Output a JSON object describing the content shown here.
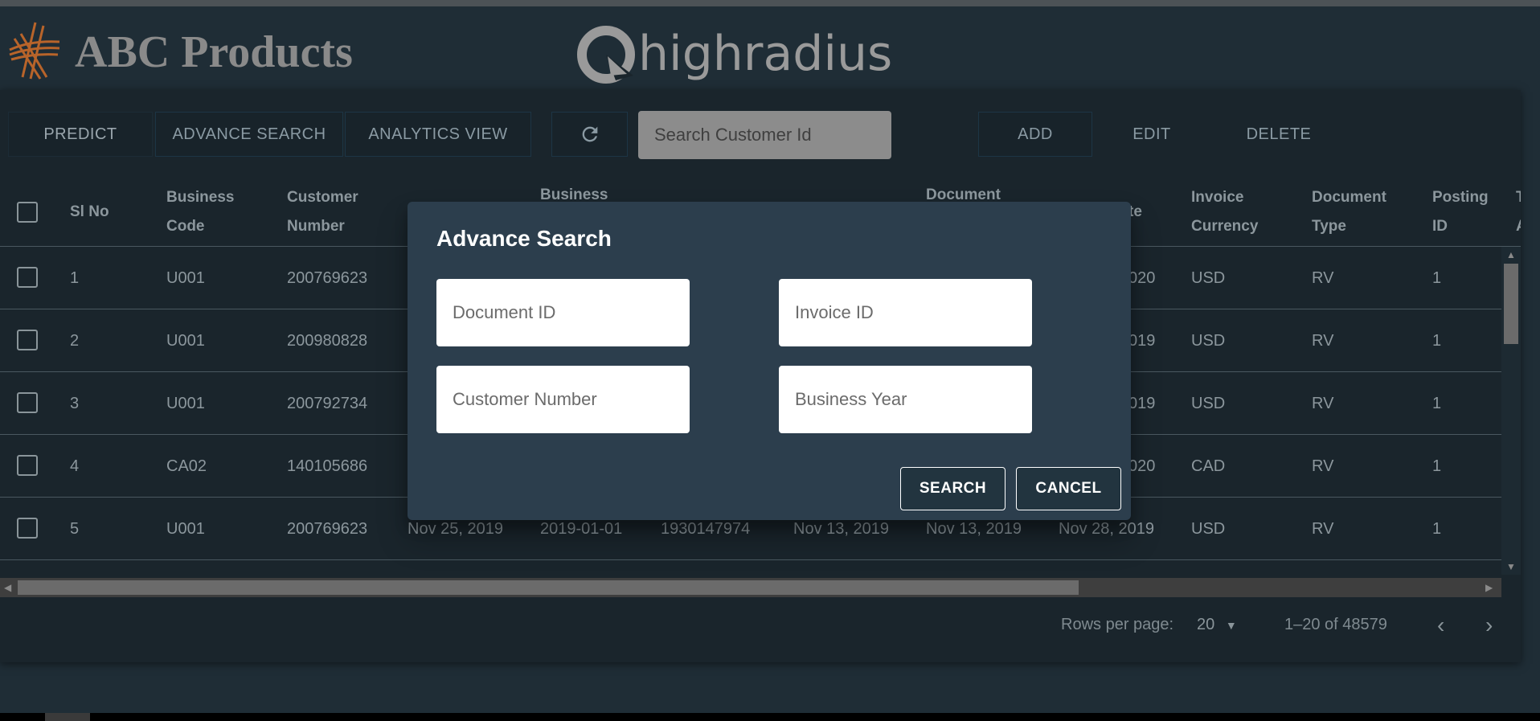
{
  "app": {
    "brand_title": "ABC Products",
    "partner_logo_text": "highradius"
  },
  "toolbar": {
    "predict_label": "PREDICT",
    "advance_search_label": "ADVANCE SEARCH",
    "analytics_view_label": "ANALYTICS VIEW",
    "search_placeholder": "Search Customer Id",
    "add_label": "ADD",
    "edit_label": "EDIT",
    "delete_label": "DELETE"
  },
  "table": {
    "headers": {
      "sl_no": "Sl No",
      "business_code_1": "Business",
      "business_code_2": "Code",
      "customer_number_1": "Customer",
      "customer_number_2": "Number",
      "business_year_1": "Business",
      "document_1": "Document",
      "date_partial": "te",
      "invoice_currency_1": "Invoice",
      "invoice_currency_2": "Currency",
      "document_type_1": "Document",
      "document_type_2": "Type",
      "posting_id_1": "Posting",
      "posting_id_2": "ID",
      "cut_1": "T",
      "cut_2": "A"
    },
    "rows": [
      {
        "sl": "1",
        "code": "U001",
        "customer": "200769623",
        "date_partial": "020",
        "currency": "USD",
        "doc_type": "RV",
        "posting": "1"
      },
      {
        "sl": "2",
        "code": "U001",
        "customer": "200980828",
        "date_partial": "019",
        "currency": "USD",
        "doc_type": "RV",
        "posting": "1"
      },
      {
        "sl": "3",
        "code": "U001",
        "customer": "200792734",
        "date_partial": "019",
        "currency": "USD",
        "doc_type": "RV",
        "posting": "1"
      },
      {
        "sl": "4",
        "code": "CA02",
        "customer": "140105686",
        "date_partial": "020",
        "currency": "CAD",
        "doc_type": "RV",
        "posting": "1"
      },
      {
        "sl": "5",
        "code": "U001",
        "customer": "200769623",
        "clear_date": "Nov 25, 2019",
        "business_year": "2019-01-01",
        "doc_id": "1930147974",
        "posting_date": "Nov 13, 2019",
        "doc_create_date": "Nov 13, 2019",
        "due_date": "Nov 28, 2019",
        "currency": "USD",
        "doc_type": "RV",
        "posting": "1"
      }
    ]
  },
  "footer": {
    "rows_per_page_label": "Rows per page:",
    "rows_per_page_value": "20",
    "range_text": "1–20 of 48579"
  },
  "dialog": {
    "title": "Advance Search",
    "document_id_placeholder": "Document ID",
    "invoice_id_placeholder": "Invoice ID",
    "customer_number_placeholder": "Customer Number",
    "business_year_placeholder": "Business Year",
    "search_label": "SEARCH",
    "cancel_label": "CANCEL"
  }
}
